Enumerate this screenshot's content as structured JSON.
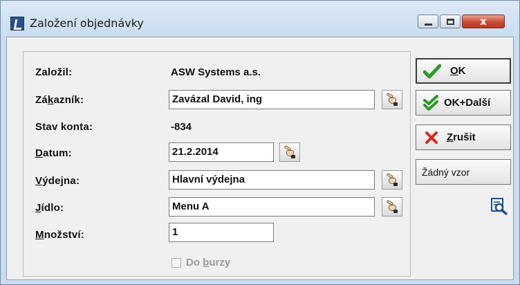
{
  "window": {
    "title": "Založení objednávky",
    "close_glyph": "x",
    "accent_color": "#c9dcf0"
  },
  "form": {
    "zalozil": {
      "label": "Založil:",
      "value": "ASW Systems a.s."
    },
    "zakaznik": {
      "label_pre": "Zá",
      "label_ul": "k",
      "label_post": "azník:",
      "value": "Zavázal David, ing"
    },
    "stav_konta": {
      "label": "Stav konta:",
      "value": "-834"
    },
    "datum": {
      "label_ul": "D",
      "label_post": "atum:",
      "value": "21.2.2014"
    },
    "vydejna": {
      "label_ul": "V",
      "label_post": "ýdejna:",
      "value": "Hlavní výdejna"
    },
    "jidlo": {
      "label_ul": "J",
      "label_post": "ídlo:",
      "value": "Menu A"
    },
    "mnozstvi": {
      "label_ul": "M",
      "label_post": "nožství:",
      "value": "1"
    },
    "do_burzy": {
      "label_pre": "Do ",
      "label_ul": "b",
      "label_post": "urzy",
      "checked": false
    }
  },
  "buttons": {
    "ok": {
      "label_ul": "O",
      "label_post": "K",
      "icon": "checkmark-icon"
    },
    "ok_dalsi": {
      "label": "OK+Další",
      "icon": "double-checkmark-icon"
    },
    "zrusit": {
      "label_ul": "Z",
      "label_post": "rušit",
      "icon": "red-x-icon"
    },
    "zadny_vzor": {
      "label": "Žádný vzor"
    }
  },
  "icons": {
    "picker": "pointing-hand-icon",
    "app": "app-icon",
    "tool": "search-document-icon"
  }
}
